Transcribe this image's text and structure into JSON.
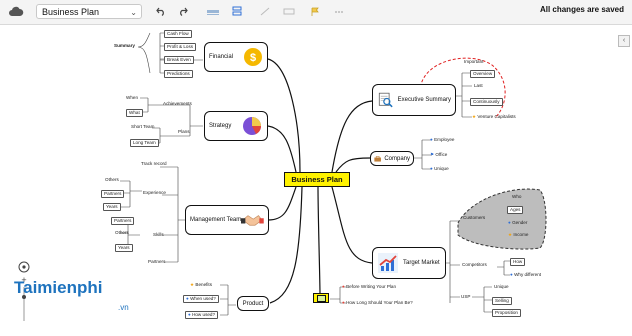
{
  "toolbar": {
    "doc_title": "Business Plan",
    "status": "All changes are saved"
  },
  "central": "Business Plan",
  "topics": {
    "financial": "Financial",
    "strategy": "Strategy",
    "management": "Management Team",
    "executive": "Executive Summary",
    "company": "Company",
    "target": "Target Market",
    "product": "Product"
  },
  "financial": {
    "summary": "Summary",
    "items": [
      "Cash Flow",
      "Profit & Loss",
      "Break Even",
      "Predictions"
    ]
  },
  "strategy": {
    "achievements": "Achievements",
    "when": "When",
    "what": "What",
    "plans": "Plans",
    "short_team": "Short Team",
    "long_team": "Long Team"
  },
  "management": {
    "track_record": "Track record",
    "experience": "Experience",
    "others": "Others",
    "partners": "Partners",
    "years": "Years",
    "skills": "Skills",
    "others2": "Others",
    "partners2": "Partners",
    "years2": "Years",
    "partners3": "Partners"
  },
  "executive": {
    "important": "Important",
    "overview": "Overview",
    "last": "Last",
    "continuously": "Continuously",
    "venture": "Venture Capitalists"
  },
  "company": {
    "items": [
      "Employee",
      "Office",
      "Unique"
    ]
  },
  "target": {
    "customers": "Customers",
    "who": "Who",
    "ages": "Ages",
    "gender": "Gender",
    "income": "Income",
    "competitors": "Competitors",
    "how": "How",
    "why_different": "Why different",
    "usp": "USP",
    "unique": "Unique",
    "selling": "Selling",
    "proposition": "Proposition"
  },
  "product": {
    "benefits": "Benefits",
    "when_used": "When used?",
    "how_used": "How used?"
  },
  "notes": {
    "before": "Before Writing Your Plan",
    "how_long": "How Long Should Your Plan Be?"
  },
  "brand": {
    "name": "Taimienphi",
    "suffix": ".vn"
  },
  "colors": {
    "central_fill": "#fff200",
    "accent_red": "#e02020",
    "brand_blue": "#1e73be",
    "selection_gray": "#bdbdbd"
  }
}
